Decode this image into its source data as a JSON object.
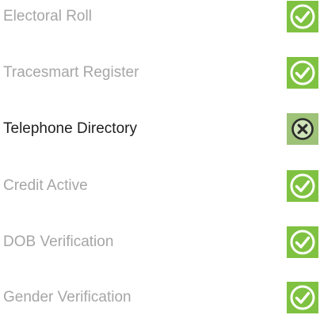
{
  "colors": {
    "pass_bg": "#7fc241",
    "fail_bg": "#9dc278",
    "label_muted": "#a6a6a6",
    "label_active": "#1f1f1f"
  },
  "checks": [
    {
      "label": "Electoral Roll",
      "status": "pass",
      "icon": "check-circle-icon"
    },
    {
      "label": "Tracesmart Register",
      "status": "pass",
      "icon": "check-circle-icon"
    },
    {
      "label": "Telephone Directory",
      "status": "fail",
      "icon": "cross-circle-icon"
    },
    {
      "label": "Credit Active",
      "status": "pass",
      "icon": "check-circle-icon"
    },
    {
      "label": "DOB Verification",
      "status": "pass",
      "icon": "check-circle-icon"
    },
    {
      "label": "Gender Verification",
      "status": "pass",
      "icon": "check-circle-icon"
    }
  ]
}
